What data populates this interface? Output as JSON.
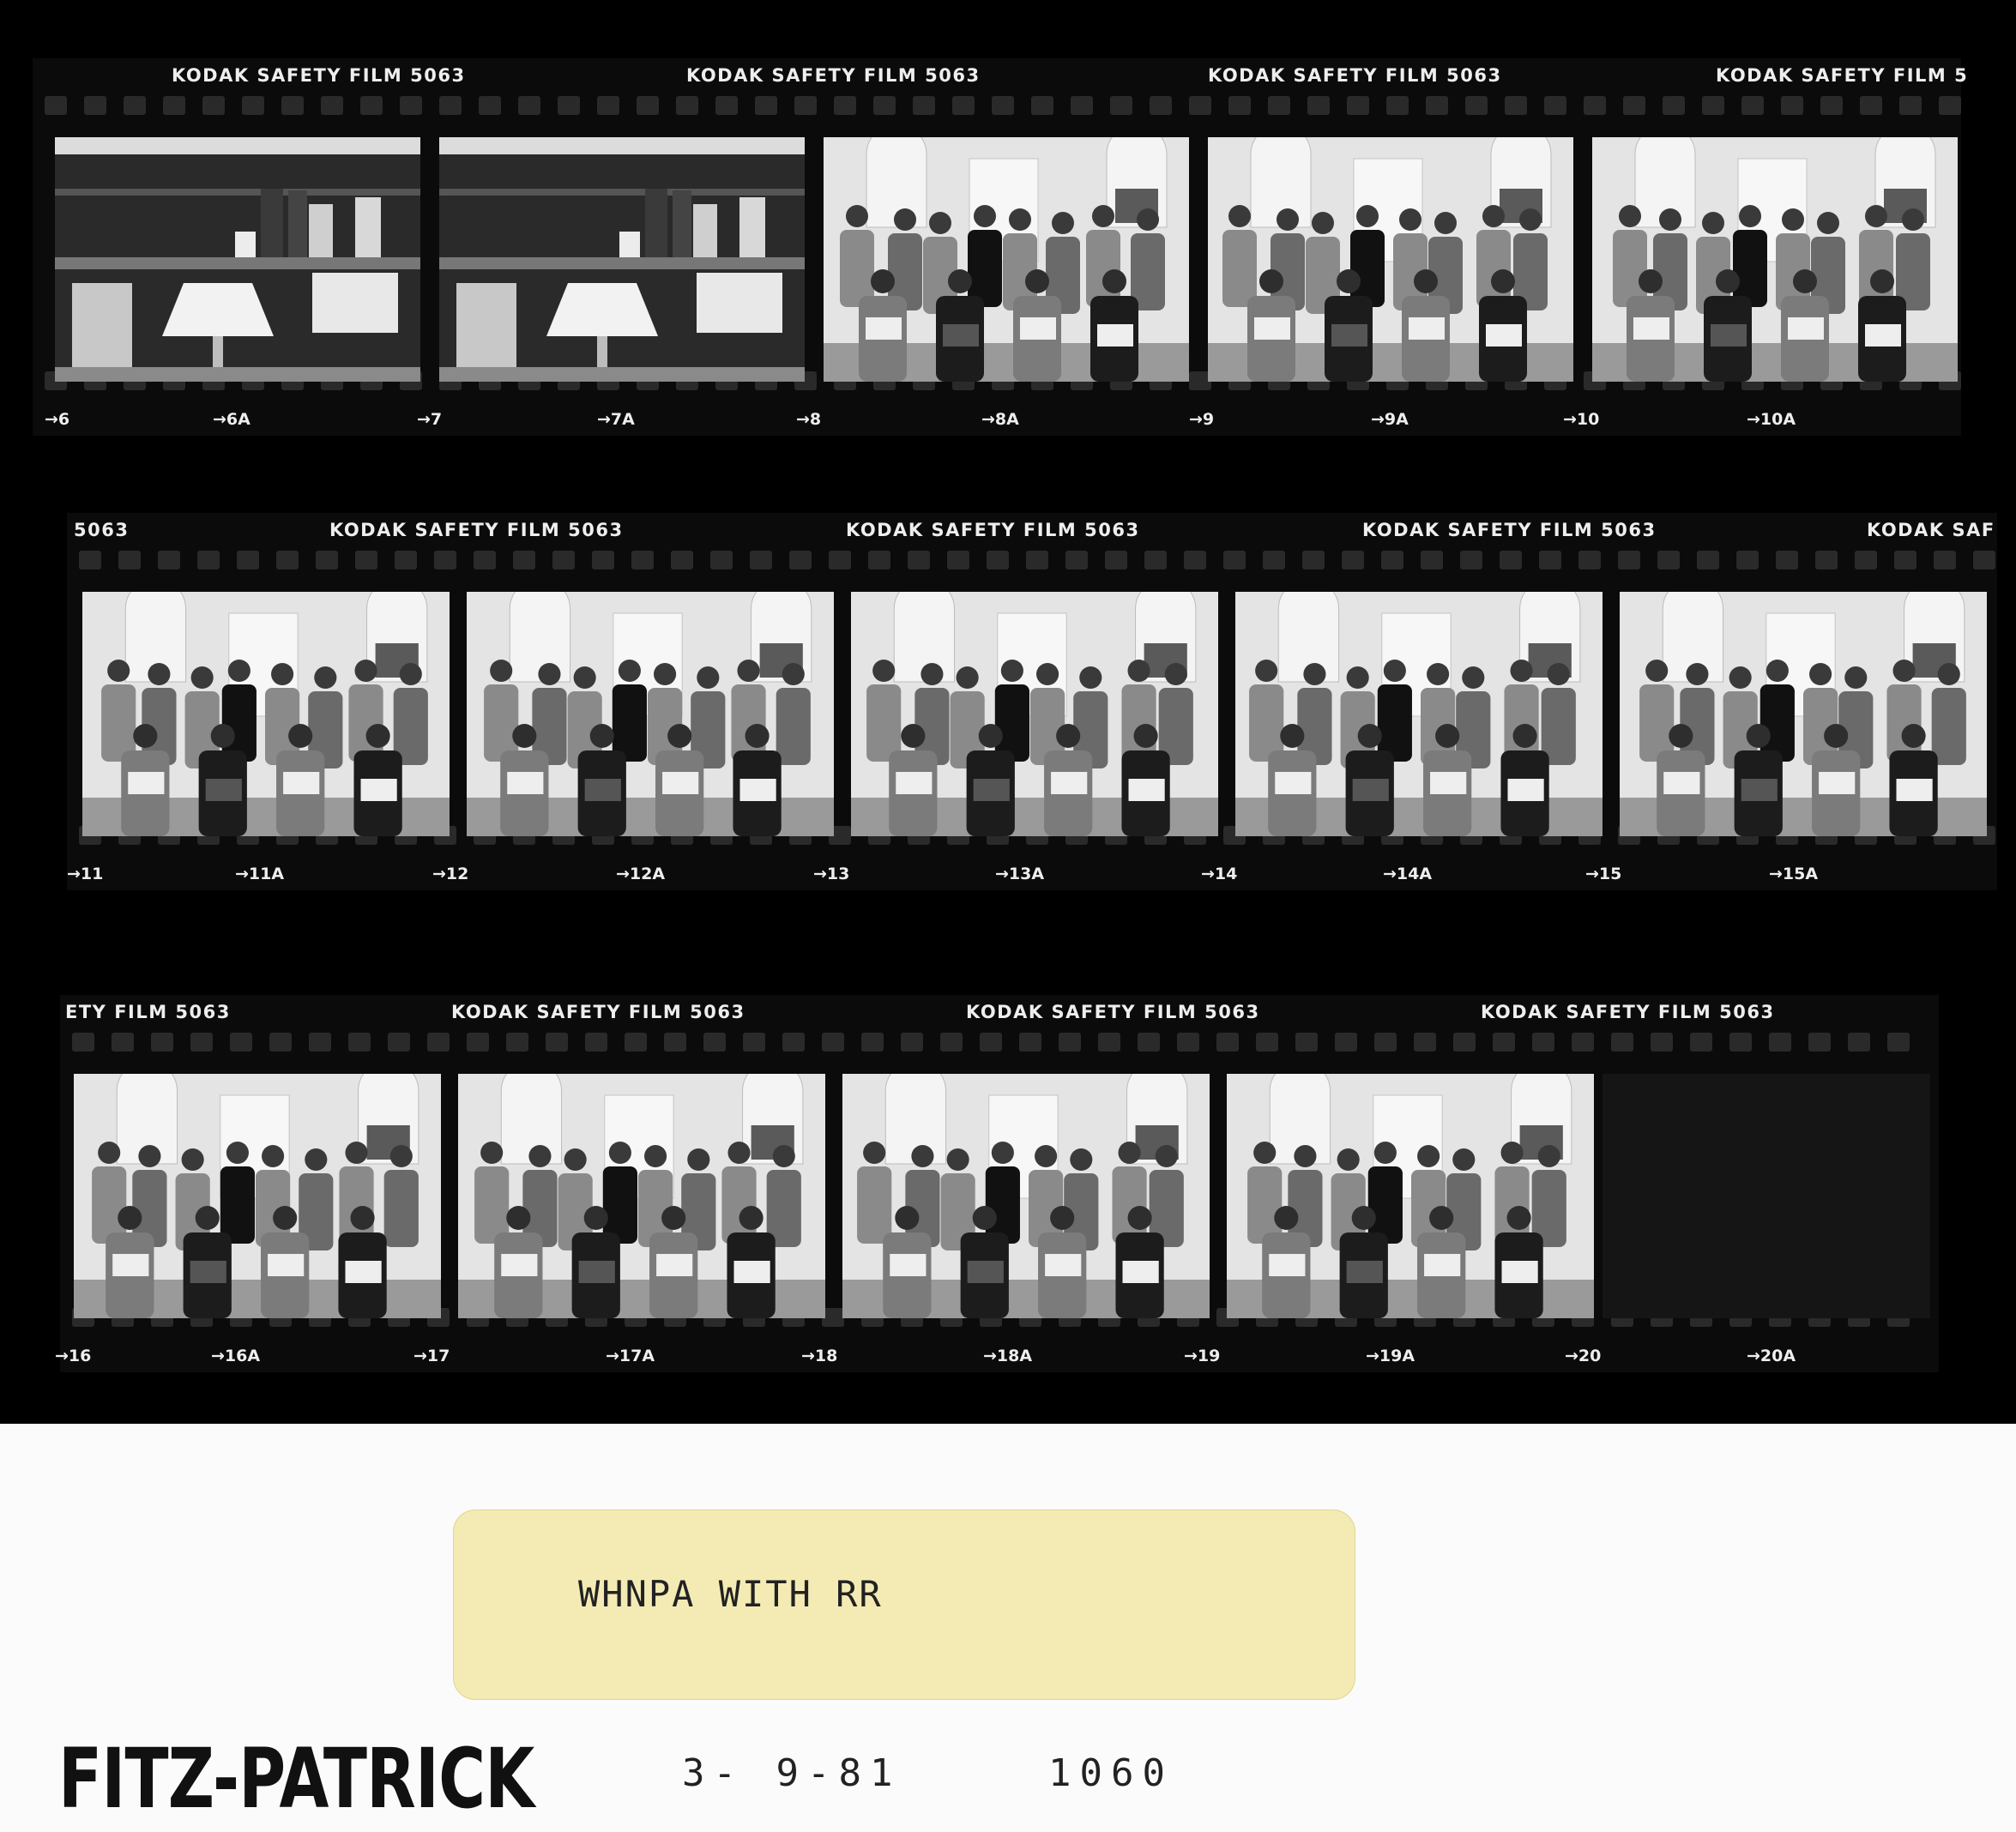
{
  "strips": [
    {
      "edge_labels": [
        "KODAK SAFETY FILM 5063",
        "KODAK SAFETY FILM 5063",
        "KODAK SAFETY FILM 5063",
        "KODAK SAFETY FILM 5"
      ],
      "frame_numbers": [
        "→6",
        "→6A",
        "→7",
        "→7A",
        "→8",
        "→8A",
        "→9",
        "→9A",
        "→10",
        "→10A"
      ],
      "frames": [
        "shelf",
        "shelf",
        "group",
        "group",
        "group"
      ]
    },
    {
      "edge_labels": [
        "5063",
        "KODAK SAFETY FILM 5063",
        "KODAK SAFETY FILM 5063",
        "KODAK SAFETY FILM 5063",
        "KODAK SAF"
      ],
      "frame_numbers": [
        "→11",
        "→11A",
        "→12",
        "→12A",
        "→13",
        "→13A",
        "→14",
        "→14A",
        "→15",
        "→15A"
      ],
      "frames": [
        "group",
        "group",
        "group",
        "group",
        "group"
      ]
    },
    {
      "edge_labels": [
        "ETY FILM 5063",
        "KODAK SAFETY FILM 5063",
        "KODAK SAFETY FILM 5063",
        "KODAK SAFETY FILM 5063"
      ],
      "frame_numbers": [
        "→16",
        "→16A",
        "→17",
        "→17A",
        "→18",
        "→18A",
        "→19",
        "→19A",
        "→20",
        "→20A"
      ],
      "frames": [
        "group",
        "group",
        "group",
        "group",
        "blank"
      ]
    }
  ],
  "label_card": {
    "text": "WHNPA WITH RR"
  },
  "photographer": "FITZ-PATRICK",
  "date": "3- 9-81",
  "roll_number": "1060"
}
